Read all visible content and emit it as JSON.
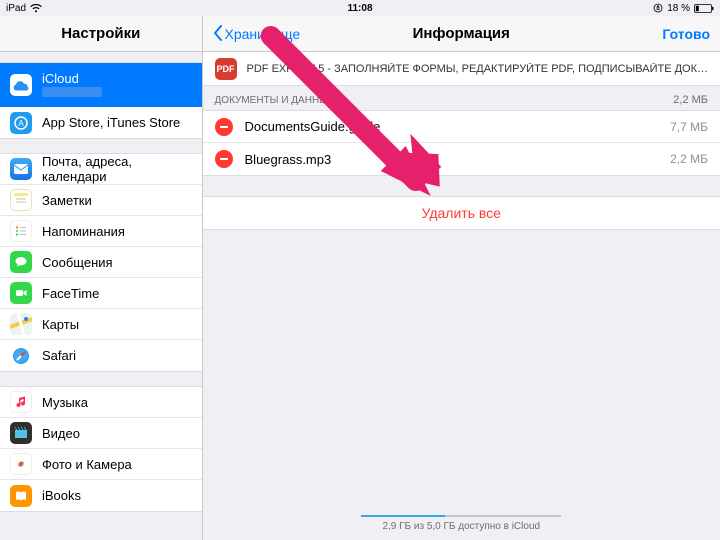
{
  "statusbar": {
    "device": "iPad",
    "time": "11:08",
    "battery_pct": "18 %"
  },
  "left": {
    "title": "Настройки",
    "icloud": {
      "label": "iCloud",
      "sub": ""
    },
    "groups": [
      {
        "items": [
          {
            "key": "icloud",
            "label": "iCloud"
          },
          {
            "key": "appstore",
            "label": "App Store, iTunes Store"
          }
        ]
      },
      {
        "items": [
          {
            "key": "mail",
            "label": "Почта, адреса, календари"
          },
          {
            "key": "notes",
            "label": "Заметки"
          },
          {
            "key": "reminders",
            "label": "Напоминания"
          },
          {
            "key": "messages",
            "label": "Сообщения"
          },
          {
            "key": "facetime",
            "label": "FaceTime"
          },
          {
            "key": "maps",
            "label": "Карты"
          },
          {
            "key": "safari",
            "label": "Safari"
          }
        ]
      },
      {
        "items": [
          {
            "key": "music",
            "label": "Музыка"
          },
          {
            "key": "video",
            "label": "Видео"
          },
          {
            "key": "photos",
            "label": "Фото и Камера"
          },
          {
            "key": "ibooks",
            "label": "iBooks"
          }
        ]
      }
    ]
  },
  "right": {
    "back_label": "Хранилище",
    "title": "Информация",
    "done_label": "Готово",
    "app_name": "PDF EXPERT 5 - ЗАПОЛНЯЙТЕ ФОРМЫ, РЕДАКТИРУЙТЕ PDF, ПОДПИСЫВАЙТЕ ДОК…",
    "section_header": "ДОКУМЕНТЫ И ДАННЫЕ",
    "section_total": "2,2 МБ",
    "files": [
      {
        "name": "DocumentsGuide.guide",
        "size": "7,7 МБ"
      },
      {
        "name": "Bluegrass.mp3",
        "size": "2,2 МБ"
      }
    ],
    "delete_all": "Удалить все",
    "footer": "2,9 ГБ из 5,0 ГБ доступно в iCloud",
    "footer_fill_pct": 42
  },
  "icons": {
    "icloud": {
      "bg": "#fff",
      "fg": "#2393f3",
      "glyph": "cloud"
    },
    "appstore": {
      "bg": "#1f9cf0",
      "fg": "#fff",
      "glyph": "A"
    },
    "mail": {
      "bg": "#1f9cf0",
      "fg": "#fff",
      "glyph": "mail"
    },
    "notes": {
      "bg": "#fff",
      "border": "#e0d59a",
      "fg": "#8a8a45",
      "glyph": "lines"
    },
    "reminders": {
      "bg": "#fff",
      "fg": "#ff9500",
      "glyph": "bullets"
    },
    "messages": {
      "bg": "#32d74b",
      "fg": "#fff",
      "glyph": "bubble"
    },
    "facetime": {
      "bg": "#32d74b",
      "fg": "#fff",
      "glyph": "video"
    },
    "maps": {
      "bg": "#f2f2f7",
      "fg": "#3478f6",
      "glyph": "map"
    },
    "safari": {
      "bg": "#fff",
      "fg": "#1f9cf0",
      "glyph": "compass"
    },
    "music": {
      "bg": "#fff",
      "fg": "#ff2d55",
      "glyph": "note"
    },
    "video": {
      "bg": "#32302a",
      "fg": "#56c1e8",
      "glyph": "clap"
    },
    "photos": {
      "bg": "#fff",
      "fg": "#ff9500",
      "glyph": "flower"
    },
    "ibooks": {
      "bg": "#ff9500",
      "fg": "#fff",
      "glyph": "book"
    }
  }
}
